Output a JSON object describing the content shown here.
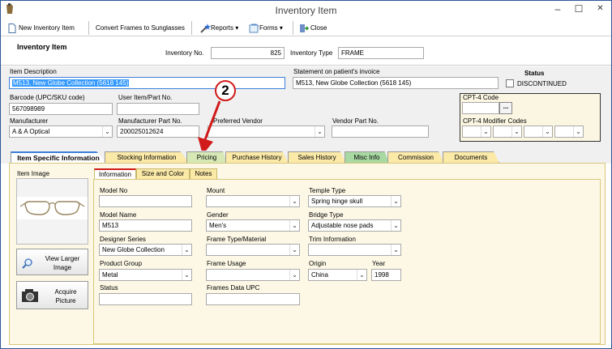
{
  "window": {
    "title": "Inventory Item",
    "minimize": "–",
    "maximize": "☐",
    "close": "✕"
  },
  "toolbar": {
    "new_item": "New Inventory Item",
    "convert": "Convert Frames to Sunglasses",
    "reports": "Reports",
    "forms": "Forms",
    "close": "Close"
  },
  "header": {
    "section_title": "Inventory Item",
    "inventory_no_label": "Inventory No.",
    "inventory_no": "825",
    "inventory_type_label": "Inventory Type",
    "inventory_type": "FRAME"
  },
  "form": {
    "item_description_label": "Item Description",
    "item_description": "M513, New Globe Collection (5618  145)",
    "statement_label": "Statement on patient's invoice",
    "statement": "M513, New Globe Collection (5618  145)",
    "status_label": "Status",
    "discontinued_label": "DISCONTINUED",
    "barcode_label": "Barcode (UPC/SKU code)",
    "barcode": "567098989",
    "user_item_label": "User Item/Part No.",
    "user_item": "",
    "manufacturer_label": "Manufacturer",
    "manufacturer": "A & A Optical",
    "mfr_part_label": "Manufacturer Part No.",
    "mfr_part": "200025012624",
    "vendor_label": "Preferred Vendor",
    "vendor": "",
    "vendor_part_label": "Vendor Part No.",
    "vendor_part": "",
    "cpt4_label": "CPT-4 Code",
    "cpt4_button": "...",
    "cpt4_mod_label": "CPT-4 Modifier Codes"
  },
  "annotation": {
    "number": "2"
  },
  "tabs": [
    "Item Specific Information",
    "Stocking Information",
    "Pricing",
    "Purchase History",
    "Sales History",
    "Misc Info",
    "Commission",
    "Documents"
  ],
  "tab_colors": [
    "#ffffff",
    "#fbe9a8",
    "#d6e9b5",
    "#fbe9a8",
    "#fbe9a8",
    "#a9d9a3",
    "#fbe9a8",
    "#fbe9a8"
  ],
  "item_image_label": "Item Image",
  "buttons": {
    "view_larger": "View Larger Image",
    "acquire": "Acquire Picture"
  },
  "inner_tabs": [
    "Information",
    "Size and Color",
    "Notes"
  ],
  "fields": {
    "model_no_label": "Model No",
    "model_no": "",
    "model_name_label": "Model Name",
    "model_name": "M513",
    "designer_label": "Designer Series",
    "designer": "New Globe Collection",
    "product_group_label": "Product Group",
    "product_group": "Metal",
    "status_label": "Status",
    "status": "",
    "mount_label": "Mount",
    "mount": "",
    "gender_label": "Gender",
    "gender": "Men's",
    "frame_type_label": "Frame Type/Material",
    "frame_type": "",
    "frame_usage_label": "Frame Usage",
    "frame_usage": "",
    "frames_upc_label": "Frames Data UPC",
    "frames_upc": "",
    "temple_label": "Temple Type",
    "temple": "Spring hinge skull",
    "bridge_label": "Bridge Type",
    "bridge": "Adjustable nose pads",
    "trim_label": "Trim Information",
    "trim": "",
    "origin_label": "Origin",
    "origin": "China",
    "year_label": "Year",
    "year": "1998"
  }
}
